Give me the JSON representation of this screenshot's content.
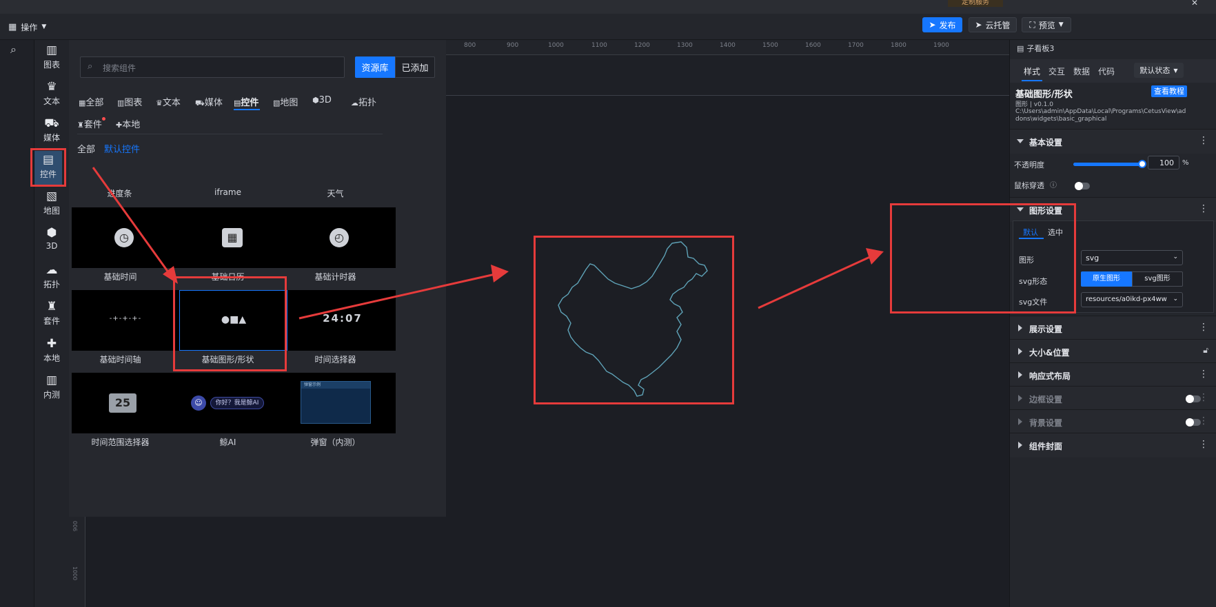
{
  "titlebar": {
    "badge": "定制服务",
    "close_glyph": "✕"
  },
  "toolbar": {
    "menu_label": "操作",
    "publish_label": "发布",
    "cloud_label": "云托管",
    "preview_label": "预览"
  },
  "icon_rail": {
    "search_icon": "search-icon"
  },
  "category_rail": {
    "items": [
      {
        "label": "图表",
        "icon": "chart-icon",
        "glyph": "▥"
      },
      {
        "label": "文本",
        "icon": "text-icon",
        "glyph": "♛"
      },
      {
        "label": "媒体",
        "icon": "media-icon",
        "glyph": "⛟"
      },
      {
        "label": "控件",
        "icon": "control-icon",
        "glyph": "▤"
      },
      {
        "label": "地图",
        "icon": "map-icon",
        "glyph": "▧"
      },
      {
        "label": "3D",
        "icon": "cube-icon",
        "glyph": "⬢"
      },
      {
        "label": "拓扑",
        "icon": "topology-icon",
        "glyph": "☁"
      },
      {
        "label": "套件",
        "icon": "suite-icon",
        "glyph": "♜"
      },
      {
        "label": "本地",
        "icon": "puzzle-icon",
        "glyph": "✚"
      },
      {
        "label": "内测",
        "icon": "beta-icon",
        "glyph": "▥"
      }
    ],
    "active_index": 3
  },
  "component_panel": {
    "search_placeholder": "搜索组件",
    "source_tabs": [
      "资源库",
      "已添加"
    ],
    "type_tabs": [
      {
        "label": "全部",
        "glyph": "▦"
      },
      {
        "label": "图表",
        "glyph": "▥"
      },
      {
        "label": "文本",
        "glyph": "♛"
      },
      {
        "label": "媒体",
        "glyph": "⛟"
      },
      {
        "label": "控件",
        "glyph": "▤"
      },
      {
        "label": "地图",
        "glyph": "▧"
      },
      {
        "label": "3D",
        "glyph": "⬢"
      },
      {
        "label": "拓扑",
        "glyph": "☁"
      },
      {
        "label": "套件",
        "glyph": "♜"
      },
      {
        "label": "本地",
        "glyph": "✚"
      }
    ],
    "active_type": "控件",
    "filter_tabs": [
      "全部",
      "默认控件"
    ],
    "partial_row_labels": [
      "进度条",
      "iframe",
      "天气"
    ],
    "cards": [
      {
        "label": "基础时间",
        "glyph": "◷"
      },
      {
        "label": "基础日历",
        "glyph": "▦"
      },
      {
        "label": "基础计时器",
        "glyph": "◴"
      },
      {
        "label": "基础时间轴",
        "glyph": "-+-+-+-"
      },
      {
        "label": "基础图形/形状",
        "glyph": "●■▲"
      },
      {
        "label": "时间选择器",
        "glyph": "24:07"
      },
      {
        "label": "时间范围选择器",
        "glyph": "25"
      },
      {
        "label": "鲸AI",
        "glyph": "你好？我是鲸AI"
      },
      {
        "label": "弹窗（内测）",
        "glyph": "弹窗示例"
      }
    ]
  },
  "ruler": {
    "ticks": [
      "800",
      "900",
      "1000",
      "1100",
      "1200",
      "1300",
      "1400",
      "1500",
      "1600",
      "1700",
      "1800",
      "1900"
    ],
    "side_ticks": [
      "006",
      "1000"
    ]
  },
  "right_panel": {
    "breadcrumb": "子看板3",
    "tabs": [
      "样式",
      "交互",
      "数据",
      "代码"
    ],
    "state_select": "默认状态",
    "component_title": "基础图形/形状",
    "tutorial_button": "查看教程",
    "version": "图形 | v0.1.0",
    "path": "C:\\Users\\admin\\AppData\\Local\\Programs\\CetusView\\addons\\widgets\\basic_graphical",
    "basic_settings": {
      "title": "基本设置",
      "opacity_label": "不透明度",
      "opacity_value": "100",
      "opacity_unit": "%",
      "opacity_level": 1.0,
      "mouse_through_label": "鼠标穿透"
    },
    "shape_settings": {
      "title": "图形设置",
      "subtabs": [
        "默认",
        "选中"
      ],
      "shape_label": "图形",
      "shape_value": "svg",
      "svg_mode_label": "svg形态",
      "svg_mode_options": [
        "原生图形",
        "svg图形"
      ],
      "svg_file_label": "svg文件",
      "svg_file_value": "resources/a0ikd-px4ww..."
    },
    "sections": [
      "展示设置",
      "大小&位置",
      "响应式布局",
      "边框设置",
      "背景设置",
      "组件封面"
    ]
  },
  "colors": {
    "accent": "#1677ff",
    "annotation": "#e63b3b",
    "map_stroke": "#5fa3b8"
  }
}
